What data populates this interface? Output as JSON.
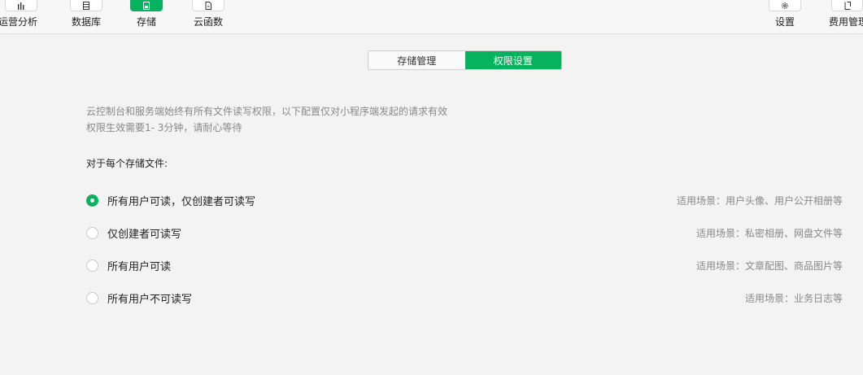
{
  "toolbar": {
    "items": [
      {
        "label": "运营分析",
        "icon": "bar-chart-icon"
      },
      {
        "label": "数据库",
        "icon": "database-icon"
      },
      {
        "label": "存储",
        "icon": "storage-icon",
        "active": true
      },
      {
        "label": "云函数",
        "icon": "cloud-function-icon"
      },
      {
        "label": "设置",
        "icon": "gear-icon"
      },
      {
        "label": "费用管理",
        "icon": "billing-icon"
      }
    ]
  },
  "tabs": [
    {
      "label": "存储管理"
    },
    {
      "label": "权限设置",
      "active": true
    }
  ],
  "description": {
    "line1": "云控制台和服务端始终有所有文件读写权限，以下配置仅对小程序端发起的请求有效",
    "line2": "权限生效需要1- 3分钟，请耐心等待"
  },
  "section_title": "对于每个存储文件:",
  "options": [
    {
      "label": "所有用户可读，仅创建者可读写",
      "scene": "适用场景：用户头像、用户公开相册等",
      "checked": true
    },
    {
      "label": "仅创建者可读写",
      "scene": "适用场景：私密相册、网盘文件等",
      "checked": false
    },
    {
      "label": "所有用户可读",
      "scene": "适用场景：文章配图、商品图片等",
      "checked": false
    },
    {
      "label": "所有用户不可读写",
      "scene": "适用场景：业务日志等",
      "checked": false
    }
  ],
  "colors": {
    "accent": "#07b25f"
  }
}
